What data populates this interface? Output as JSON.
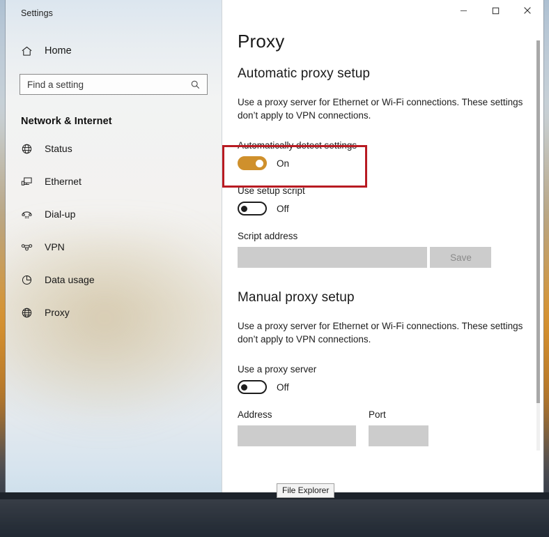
{
  "colors": {
    "accent": "#cf902c",
    "annotation": "#b81b22",
    "disabled_field": "#cccccc"
  },
  "sidebar": {
    "app_title": "Settings",
    "home_label": "Home",
    "home_icon": "home-icon",
    "search": {
      "placeholder": "Find a setting",
      "value": "",
      "icon": "search-icon"
    },
    "category": "Network & Internet",
    "items": [
      {
        "label": "Status",
        "icon": "globe-status-icon",
        "selected": false
      },
      {
        "label": "Ethernet",
        "icon": "ethernet-icon",
        "selected": false
      },
      {
        "label": "Dial-up",
        "icon": "dial-up-icon",
        "selected": false
      },
      {
        "label": "VPN",
        "icon": "vpn-icon",
        "selected": false
      },
      {
        "label": "Data usage",
        "icon": "data-usage-icon",
        "selected": false
      },
      {
        "label": "Proxy",
        "icon": "proxy-globe-icon",
        "selected": true
      }
    ]
  },
  "titlebar": {
    "minimize": "–",
    "maximize": "□",
    "close": "✕"
  },
  "main": {
    "page_title": "Proxy",
    "automatic": {
      "heading": "Automatic proxy setup",
      "description": "Use a proxy server for Ethernet or Wi-Fi connections. These settings don’t apply to VPN connections.",
      "auto_detect_label": "Automatically detect settings",
      "auto_detect_state": "On",
      "setup_script_label": "Use setup script",
      "setup_script_state": "Off",
      "script_address_label": "Script address",
      "script_address_value": "",
      "save_label": "Save"
    },
    "manual": {
      "heading": "Manual proxy setup",
      "description": "Use a proxy server for Ethernet or Wi-Fi connections. These settings don’t apply to VPN connections.",
      "use_proxy_label": "Use a proxy server",
      "use_proxy_state": "Off",
      "address_label": "Address",
      "address_value": "",
      "port_label": "Port",
      "port_value": ""
    }
  },
  "taskbar": {
    "tooltip": "File Explorer"
  }
}
